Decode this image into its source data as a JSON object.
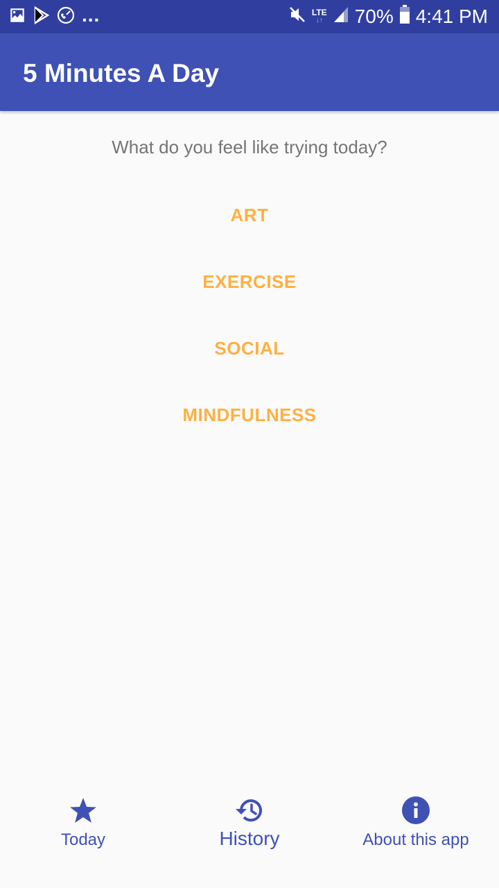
{
  "status_bar": {
    "battery": "70%",
    "time": "4:41 PM",
    "network": "LTE",
    "left_icons": [
      "image-icon",
      "play-store-icon",
      "call-icon"
    ],
    "right_icons": [
      "mute-icon",
      "signal-icon",
      "battery-icon"
    ],
    "overflow": "..."
  },
  "app_bar": {
    "title": "5 Minutes A Day"
  },
  "main": {
    "prompt": "What do you feel like trying today?",
    "choices": [
      {
        "label": "ART"
      },
      {
        "label": "EXERCISE"
      },
      {
        "label": "SOCIAL"
      },
      {
        "label": "MINDFULNESS"
      }
    ]
  },
  "bottom_nav": {
    "items": [
      {
        "label": "Today",
        "icon": "star-icon",
        "active": false
      },
      {
        "label": "History",
        "icon": "history-icon",
        "active": true
      },
      {
        "label": "About this app",
        "icon": "info-icon",
        "active": false
      }
    ]
  },
  "colors": {
    "primary": "#3f51b5",
    "primary_dark": "#303f9f",
    "accent": "#ffb040",
    "text_secondary": "#757575",
    "background": "#fafafa"
  }
}
